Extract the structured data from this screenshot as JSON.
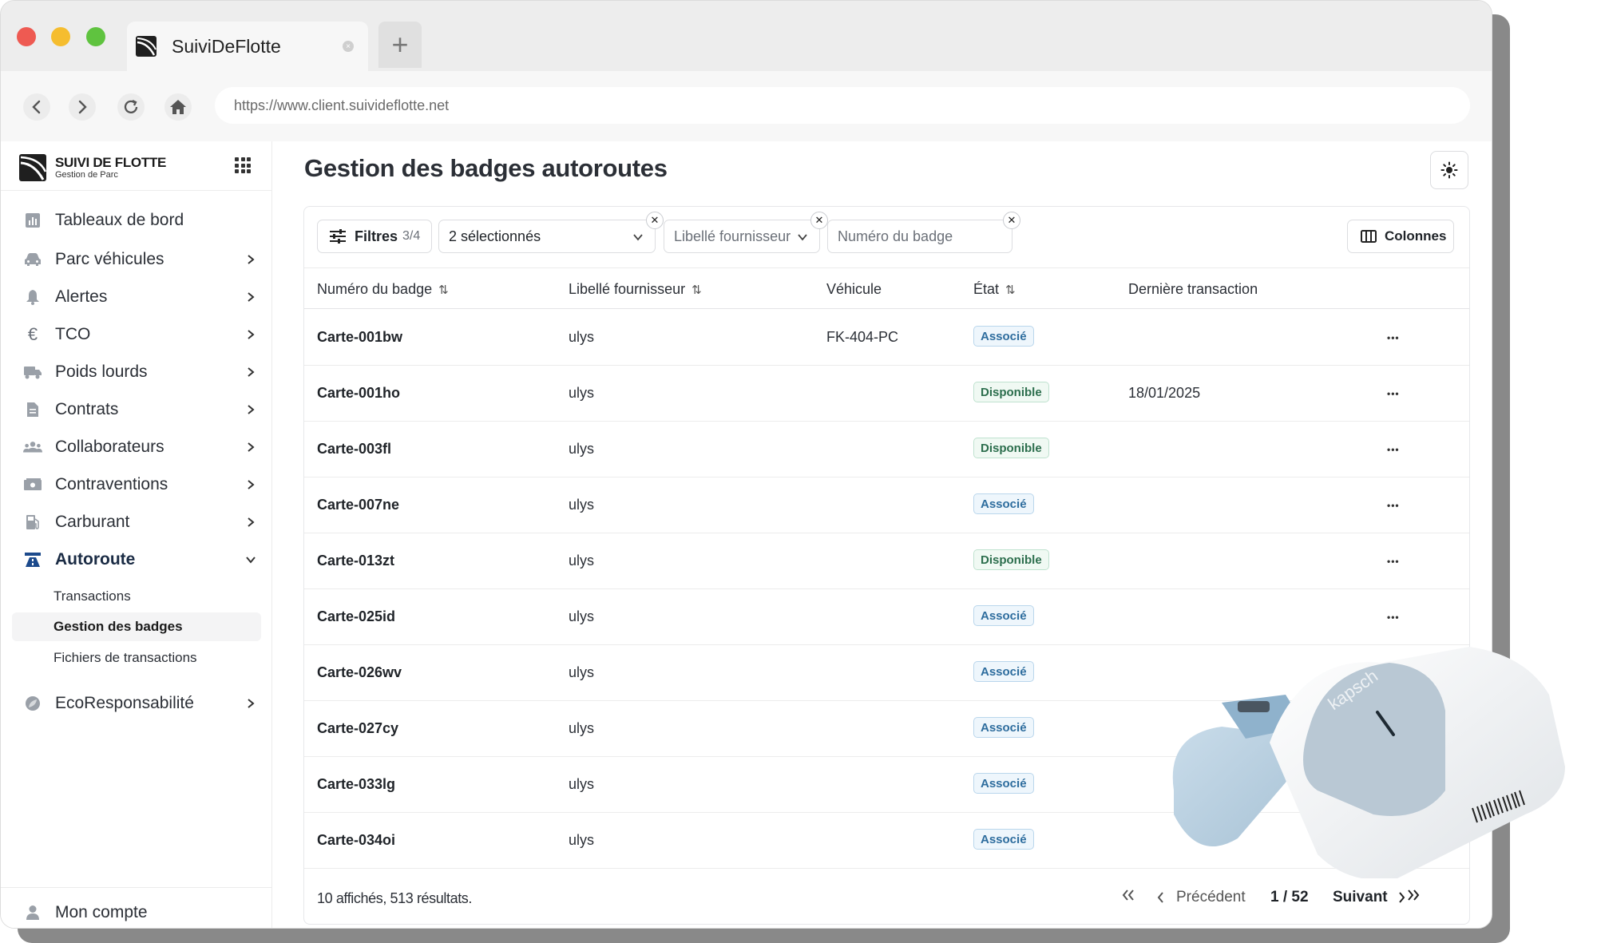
{
  "browser": {
    "tab_title": "SuiviDeFlotte",
    "url": "https://www.client.suivideflotte.net",
    "new_tab_symbol": "+"
  },
  "brand": {
    "name": "SUIVI DE FLOTTE",
    "subtitle": "Gestion de Parc"
  },
  "sidebar": {
    "items": [
      {
        "label": "Tableaux de bord",
        "icon": "dashboard-icon"
      },
      {
        "label": "Parc véhicules",
        "icon": "car-icon"
      },
      {
        "label": "Alertes",
        "icon": "bell-icon"
      },
      {
        "label": "TCO",
        "icon": "euro-icon"
      },
      {
        "label": "Poids lourds",
        "icon": "truck-icon"
      },
      {
        "label": "Contrats",
        "icon": "document-icon"
      },
      {
        "label": "Collaborateurs",
        "icon": "users-icon"
      },
      {
        "label": "Contraventions",
        "icon": "ticket-icon"
      },
      {
        "label": "Carburant",
        "icon": "fuel-icon"
      },
      {
        "label": "Autoroute",
        "icon": "highway-icon"
      },
      {
        "label": "EcoResponsabilité",
        "icon": "leaf-icon"
      }
    ],
    "sub_items": [
      {
        "label": "Transactions"
      },
      {
        "label": "Gestion des badges"
      },
      {
        "label": "Fichiers de transactions"
      }
    ],
    "account": "Mon compte"
  },
  "main": {
    "title": "Gestion des badges autoroutes",
    "filters": {
      "button_label": "Filtres",
      "button_count": "3/4",
      "selected_label": "2 sélectionnés",
      "supplier_placeholder": "Libellé fournisseur",
      "badge_placeholder": "Numéro du badge",
      "columns_label": "Colonnes"
    },
    "table": {
      "headers": {
        "badge": "Numéro du badge",
        "supplier": "Libellé fournisseur",
        "vehicle": "Véhicule",
        "state": "État",
        "last_tx": "Dernière transaction"
      },
      "rows": [
        {
          "badge": "Carte-001bw",
          "supplier": "ulys",
          "vehicle": "FK-404-PC",
          "state": "Associé",
          "last_tx": ""
        },
        {
          "badge": "Carte-001ho",
          "supplier": "ulys",
          "vehicle": "",
          "state": "Disponible",
          "last_tx": "18/01/2025"
        },
        {
          "badge": "Carte-003fl",
          "supplier": "ulys",
          "vehicle": "",
          "state": "Disponible",
          "last_tx": ""
        },
        {
          "badge": "Carte-007ne",
          "supplier": "ulys",
          "vehicle": "",
          "state": "Associé",
          "last_tx": ""
        },
        {
          "badge": "Carte-013zt",
          "supplier": "ulys",
          "vehicle": "",
          "state": "Disponible",
          "last_tx": ""
        },
        {
          "badge": "Carte-025id",
          "supplier": "ulys",
          "vehicle": "",
          "state": "Associé",
          "last_tx": ""
        },
        {
          "badge": "Carte-026wv",
          "supplier": "ulys",
          "vehicle": "",
          "state": "Associé",
          "last_tx": ""
        },
        {
          "badge": "Carte-027cy",
          "supplier": "ulys",
          "vehicle": "",
          "state": "Associé",
          "last_tx": ""
        },
        {
          "badge": "Carte-033lg",
          "supplier": "ulys",
          "vehicle": "",
          "state": "Associé",
          "last_tx": ""
        },
        {
          "badge": "Carte-034oi",
          "supplier": "ulys",
          "vehicle": "",
          "state": "Associé",
          "last_tx": ""
        }
      ]
    },
    "footer": {
      "count_text": "10 affichés, 513 résultats.",
      "prev_label": "Précédent",
      "page_text": "1 / 52",
      "next_label": "Suivant"
    }
  },
  "device_brand": "kapsch",
  "colors": {
    "associe": "#2e6d9e",
    "disponible": "#2c6e4d",
    "active_nav": "#1c4a8c"
  }
}
